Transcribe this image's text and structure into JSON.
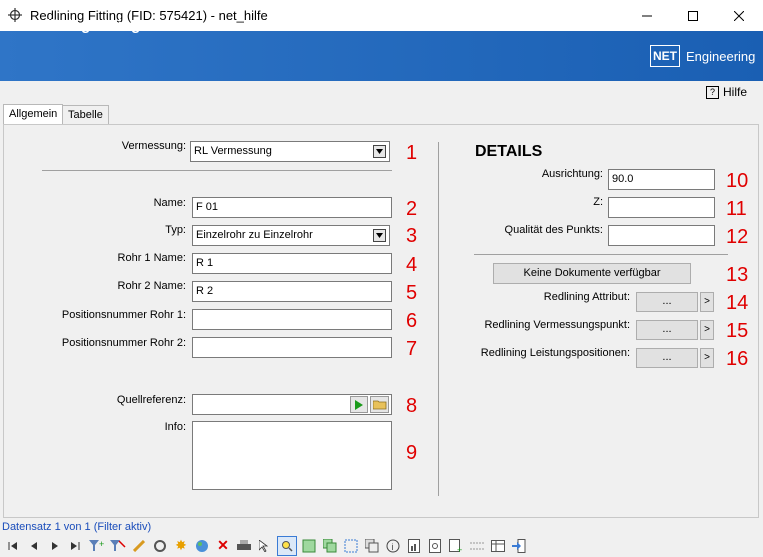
{
  "window": {
    "title": "Redlining Fitting (FID: 575421) - net_hilfe"
  },
  "banner": {
    "title": "Redlining Fitting",
    "logo_box": "NET",
    "logo_text": "Engineering"
  },
  "help": {
    "label": "Hilfe"
  },
  "tabs": [
    {
      "label": "Allgemein"
    },
    {
      "label": "Tabelle"
    }
  ],
  "left": {
    "vermessung": {
      "label": "Vermessung:",
      "value": "RL Vermessung",
      "num": "1"
    },
    "name": {
      "label": "Name:",
      "value": "F 01",
      "num": "2"
    },
    "typ": {
      "label": "Typ:",
      "value": "Einzelrohr zu Einzelrohr",
      "num": "3"
    },
    "rohr1": {
      "label": "Rohr 1 Name:",
      "value": "R 1",
      "num": "4"
    },
    "rohr2": {
      "label": "Rohr 2 Name:",
      "value": "R 2",
      "num": "5"
    },
    "posnr1": {
      "label": "Positionsnummer Rohr 1:",
      "value": "",
      "num": "6"
    },
    "posnr2": {
      "label": "Positionsnummer Rohr 2:",
      "value": "",
      "num": "7"
    },
    "quellref": {
      "label": "Quellreferenz:",
      "value": "",
      "num": "8"
    },
    "info": {
      "label": "Info:",
      "value": "",
      "num": "9"
    }
  },
  "right": {
    "heading": "DETAILS",
    "ausrichtung": {
      "label": "Ausrichtung:",
      "value": "90.0",
      "num": "10"
    },
    "z": {
      "label": "Z:",
      "value": "",
      "num": "11"
    },
    "qualitaet": {
      "label": "Qualität des Punkts:",
      "value": "",
      "num": "12"
    },
    "dokumente": {
      "label": "Keine Dokumente verfügbar",
      "num": "13"
    },
    "attribut": {
      "label": "Redlining Attribut:",
      "btn": "...",
      "arrow": ">",
      "num": "14"
    },
    "vermpunkt": {
      "label": "Redlining Vermessungspunkt:",
      "btn": "...",
      "arrow": ">",
      "num": "15"
    },
    "leistung": {
      "label": "Redlining Leistungspositionen:",
      "btn": "...",
      "arrow": ">",
      "num": "16"
    }
  },
  "status": {
    "text": "Datensatz 1 von 1 (Filter aktiv)"
  },
  "colors": {
    "banner": "#1a5fb3",
    "annotation": "#e00000",
    "status": "#1a4dbb"
  }
}
